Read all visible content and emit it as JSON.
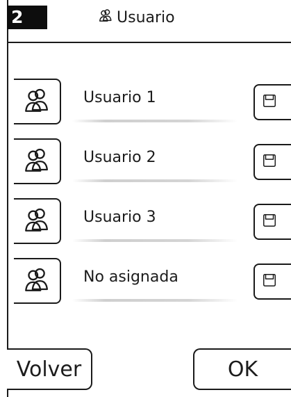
{
  "header": {
    "step_number": "2",
    "title": "Usuario",
    "title_icon": "user-pair-icon"
  },
  "users": [
    {
      "name": "Usuario 1",
      "user_icon": "user-pair-icon",
      "action_icon": "save-icon"
    },
    {
      "name": "Usuario 2",
      "user_icon": "user-pair-icon",
      "action_icon": "save-icon"
    },
    {
      "name": "Usuario 3",
      "user_icon": "user-pair-icon",
      "action_icon": "save-icon"
    },
    {
      "name": "No asignada",
      "user_icon": "user-pair-icon",
      "action_icon": "save-icon"
    }
  ],
  "footer": {
    "back_label": "Volver",
    "ok_label": "OK"
  },
  "colors": {
    "line": "#1a1a1a",
    "badge_bg": "#0d0d0d",
    "badge_text": "#ffffff",
    "underline": "#d4d4d4"
  }
}
